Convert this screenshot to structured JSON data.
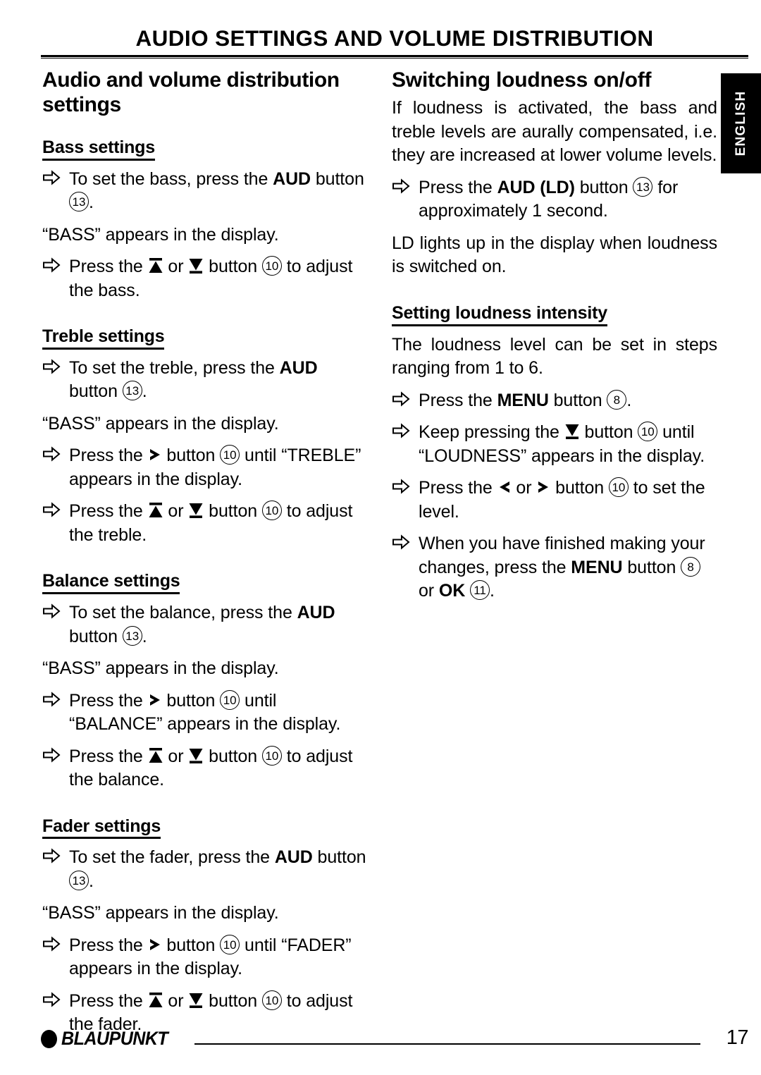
{
  "running_head": "AUDIO SETTINGS AND VOLUME DISTRIBUTION",
  "lang_tab": {
    "label": "ENGLISH"
  },
  "left_column": {
    "title": "Audio and volume distribution settings",
    "sections": [
      {
        "heading": "Bass settings",
        "blocks": [
          {
            "kind": "step",
            "parts": [
              {
                "t": "text",
                "v": "To set the bass, press the "
              },
              {
                "t": "bold",
                "v": "AUD"
              },
              {
                "t": "text",
                "v": " button "
              },
              {
                "t": "ref",
                "v": "13"
              },
              {
                "t": "text",
                "v": "."
              }
            ]
          },
          {
            "kind": "para",
            "parts": [
              {
                "t": "text",
                "v": "“BASS” appears in the display."
              }
            ]
          },
          {
            "kind": "step",
            "parts": [
              {
                "t": "text",
                "v": "Press the "
              },
              {
                "t": "glyph",
                "v": "up-arrow-button-icon"
              },
              {
                "t": "text",
                "v": " or "
              },
              {
                "t": "glyph",
                "v": "down-arrow-button-icon"
              },
              {
                "t": "text",
                "v": " button "
              },
              {
                "t": "ref",
                "v": "10"
              },
              {
                "t": "text",
                "v": " to adjust the bass."
              }
            ]
          }
        ]
      },
      {
        "heading": "Treble settings",
        "blocks": [
          {
            "kind": "step",
            "parts": [
              {
                "t": "text",
                "v": "To set the treble, press the "
              },
              {
                "t": "bold",
                "v": "AUD"
              },
              {
                "t": "text",
                "v": " button "
              },
              {
                "t": "ref",
                "v": "13"
              },
              {
                "t": "text",
                "v": "."
              }
            ]
          },
          {
            "kind": "para",
            "parts": [
              {
                "t": "text",
                "v": "“BASS” appears in the display."
              }
            ]
          },
          {
            "kind": "step",
            "parts": [
              {
                "t": "text",
                "v": "Press the "
              },
              {
                "t": "glyph",
                "v": "right-chevron-button-icon"
              },
              {
                "t": "text",
                "v": " button "
              },
              {
                "t": "ref",
                "v": "10"
              },
              {
                "t": "text",
                "v": " until “TREBLE” appears in the display."
              }
            ]
          },
          {
            "kind": "step",
            "parts": [
              {
                "t": "text",
                "v": "Press the "
              },
              {
                "t": "glyph",
                "v": "up-arrow-button-icon"
              },
              {
                "t": "text",
                "v": " or "
              },
              {
                "t": "glyph",
                "v": "down-arrow-button-icon"
              },
              {
                "t": "text",
                "v": " button "
              },
              {
                "t": "ref",
                "v": "10"
              },
              {
                "t": "text",
                "v": " to adjust the treble."
              }
            ]
          }
        ]
      },
      {
        "heading": "Balance settings",
        "blocks": [
          {
            "kind": "step",
            "parts": [
              {
                "t": "text",
                "v": "To set the balance, press the "
              },
              {
                "t": "bold",
                "v": "AUD"
              },
              {
                "t": "text",
                "v": " button "
              },
              {
                "t": "ref",
                "v": "13"
              },
              {
                "t": "text",
                "v": "."
              }
            ]
          },
          {
            "kind": "para",
            "parts": [
              {
                "t": "text",
                "v": "“BASS” appears in the display."
              }
            ]
          },
          {
            "kind": "step",
            "parts": [
              {
                "t": "text",
                "v": "Press the "
              },
              {
                "t": "glyph",
                "v": "right-chevron-button-icon"
              },
              {
                "t": "text",
                "v": " button "
              },
              {
                "t": "ref",
                "v": "10"
              },
              {
                "t": "text",
                "v": " until “BALANCE” appears in the display."
              }
            ]
          },
          {
            "kind": "step",
            "parts": [
              {
                "t": "text",
                "v": "Press the "
              },
              {
                "t": "glyph",
                "v": "up-arrow-button-icon"
              },
              {
                "t": "text",
                "v": " or "
              },
              {
                "t": "glyph",
                "v": "down-arrow-button-icon"
              },
              {
                "t": "text",
                "v": " button "
              },
              {
                "t": "ref",
                "v": "10"
              },
              {
                "t": "text",
                "v": " to adjust the balance."
              }
            ]
          }
        ]
      },
      {
        "heading": "Fader settings",
        "blocks": [
          {
            "kind": "step",
            "parts": [
              {
                "t": "text",
                "v": "To set the fader, press the "
              },
              {
                "t": "bold",
                "v": "AUD"
              },
              {
                "t": "text",
                "v": " button "
              },
              {
                "t": "ref",
                "v": "13"
              },
              {
                "t": "text",
                "v": "."
              }
            ]
          },
          {
            "kind": "para",
            "parts": [
              {
                "t": "text",
                "v": "“BASS” appears in the display."
              }
            ]
          },
          {
            "kind": "step",
            "parts": [
              {
                "t": "text",
                "v": "Press the "
              },
              {
                "t": "glyph",
                "v": "right-chevron-button-icon"
              },
              {
                "t": "text",
                "v": " button "
              },
              {
                "t": "ref",
                "v": "10"
              },
              {
                "t": "text",
                "v": " until “FADER” appears in the display."
              }
            ]
          },
          {
            "kind": "step",
            "parts": [
              {
                "t": "text",
                "v": "Press the "
              },
              {
                "t": "glyph",
                "v": "up-arrow-button-icon"
              },
              {
                "t": "text",
                "v": " or "
              },
              {
                "t": "glyph",
                "v": "down-arrow-button-icon"
              },
              {
                "t": "text",
                "v": " button "
              },
              {
                "t": "ref",
                "v": "10"
              },
              {
                "t": "text",
                "v": " to adjust the fader."
              }
            ]
          }
        ]
      }
    ]
  },
  "right_column": {
    "title": "Switching loudness on/off",
    "sections": [
      {
        "heading": null,
        "blocks": [
          {
            "kind": "para",
            "justify": true,
            "parts": [
              {
                "t": "text",
                "v": "If loudness is activated, the bass and treble levels are aurally compensated, i.e. they are increased at lower volume levels."
              }
            ]
          },
          {
            "kind": "step",
            "parts": [
              {
                "t": "text",
                "v": "Press the "
              },
              {
                "t": "bold",
                "v": "AUD (LD)"
              },
              {
                "t": "text",
                "v": " button "
              },
              {
                "t": "ref",
                "v": "13"
              },
              {
                "t": "text",
                "v": " for approximately 1 second."
              }
            ]
          },
          {
            "kind": "para",
            "justify": true,
            "parts": [
              {
                "t": "text",
                "v": "LD lights up in the display when loudness is switched on."
              }
            ]
          }
        ]
      },
      {
        "heading": "Setting loudness intensity",
        "blocks": [
          {
            "kind": "para",
            "justify": true,
            "parts": [
              {
                "t": "text",
                "v": "The loudness level can be set in steps ranging from 1 to 6."
              }
            ]
          },
          {
            "kind": "step",
            "parts": [
              {
                "t": "text",
                "v": "Press the "
              },
              {
                "t": "bold",
                "v": "MENU"
              },
              {
                "t": "text",
                "v": " button "
              },
              {
                "t": "ref",
                "v": "8"
              },
              {
                "t": "text",
                "v": "."
              }
            ]
          },
          {
            "kind": "step",
            "parts": [
              {
                "t": "text",
                "v": "Keep pressing the "
              },
              {
                "t": "glyph",
                "v": "down-arrow-button-icon"
              },
              {
                "t": "text",
                "v": " button "
              },
              {
                "t": "ref",
                "v": "10"
              },
              {
                "t": "text",
                "v": " until “LOUDNESS” appears in the display."
              }
            ]
          },
          {
            "kind": "step",
            "parts": [
              {
                "t": "text",
                "v": "Press the "
              },
              {
                "t": "glyph",
                "v": "left-chevron-button-icon"
              },
              {
                "t": "text",
                "v": " or "
              },
              {
                "t": "glyph",
                "v": "right-chevron-button-icon"
              },
              {
                "t": "text",
                "v": " button "
              },
              {
                "t": "ref",
                "v": "10"
              },
              {
                "t": "text",
                "v": " to set the level."
              }
            ]
          },
          {
            "kind": "step",
            "parts": [
              {
                "t": "text",
                "v": "When you have finished making your changes, press the "
              },
              {
                "t": "bold",
                "v": "MENU"
              },
              {
                "t": "text",
                "v": " button "
              },
              {
                "t": "ref",
                "v": "8"
              },
              {
                "t": "text",
                "v": " or "
              },
              {
                "t": "bold",
                "v": "OK"
              },
              {
                "t": "text",
                "v": " "
              },
              {
                "t": "ref",
                "v": "11"
              },
              {
                "t": "text",
                "v": "."
              }
            ]
          }
        ]
      }
    ]
  },
  "footer": {
    "brand": "BLAUPUNKT",
    "page_number": "17"
  },
  "colors": {
    "ink": "#000000",
    "paper": "#ffffff",
    "tab_background": "#000000",
    "tab_text": "#ffffff"
  }
}
